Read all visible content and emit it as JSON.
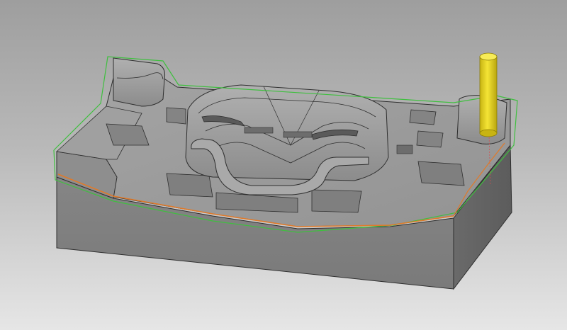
{
  "viewport": {
    "background_top": "#9e9e9e",
    "background_bottom": "#e6e6e6",
    "view": "isometric"
  },
  "colors": {
    "part_face": "#8f8f8f",
    "part_top": "#9b9b9b",
    "part_side_dark": "#6e6e6e",
    "part_side_light": "#8a8a8a",
    "edge": "#2e2e2e",
    "stock_boundary": "#3fbf3f",
    "toolpath_boundary": "#e07a2a",
    "tool": "#e8d51e",
    "tool_shadow": "#b9a60f",
    "highlight": "#d8d8d8"
  },
  "objects": [
    {
      "name": "mold-block",
      "kind": "part"
    },
    {
      "name": "cutting-tool",
      "kind": "tool",
      "shape": "cylinder"
    },
    {
      "name": "stock-boundary",
      "kind": "curve"
    },
    {
      "name": "toolpath-boundary",
      "kind": "curve"
    }
  ]
}
